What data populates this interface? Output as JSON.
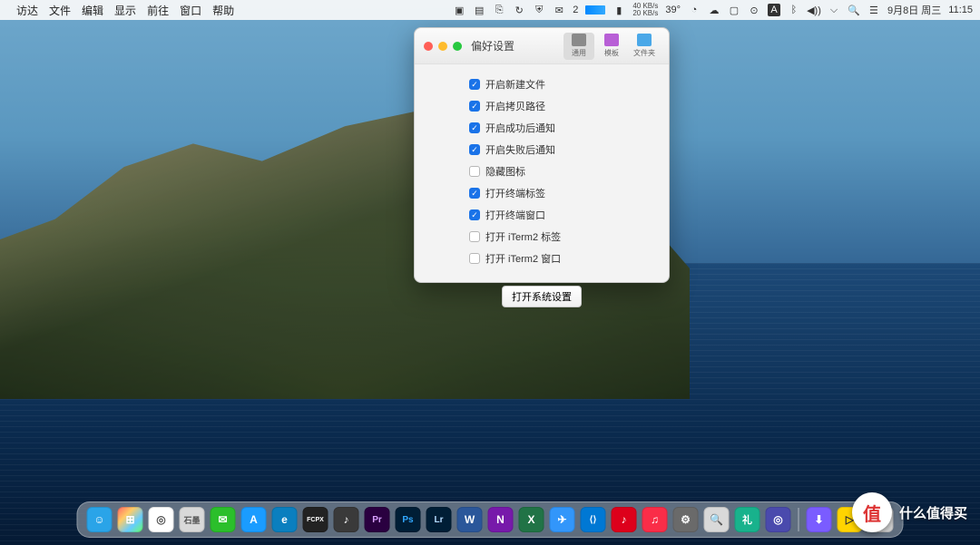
{
  "menubar": {
    "apple": "",
    "items": [
      "访达",
      "文件",
      "编辑",
      "显示",
      "前往",
      "窗口",
      "帮助"
    ],
    "status": {
      "badge_count": "2",
      "net_up": "40 KB/s",
      "net_dn": "20 KB/s",
      "temp": "39°",
      "date": "9月8日 周三",
      "time": "11:15"
    }
  },
  "panel": {
    "title": "偏好设置",
    "tabs": [
      {
        "key": "general",
        "label": "通用",
        "active": true
      },
      {
        "key": "template",
        "label": "模板",
        "active": false
      },
      {
        "key": "folder",
        "label": "文件夹",
        "active": false
      }
    ],
    "options": [
      {
        "key": "new_file",
        "label": "开启新建文件",
        "checked": true
      },
      {
        "key": "copy_path",
        "label": "开启拷贝路径",
        "checked": true
      },
      {
        "key": "success_notify",
        "label": "开启成功后通知",
        "checked": true
      },
      {
        "key": "fail_notify",
        "label": "开启失败后通知",
        "checked": true
      },
      {
        "key": "hide_icon",
        "label": "隐藏图标",
        "checked": false
      },
      {
        "key": "open_term_tab",
        "label": "打开终端标签",
        "checked": true
      },
      {
        "key": "open_term_win",
        "label": "打开终端窗口",
        "checked": true
      },
      {
        "key": "open_iterm_tab",
        "label": "打开 iTerm2 标签",
        "checked": false
      },
      {
        "key": "open_iterm_win",
        "label": "打开 iTerm2 窗口",
        "checked": false
      }
    ],
    "sys_button": "打开系统设置"
  },
  "dock": {
    "apps": [
      {
        "key": "finder",
        "glyph": "☺",
        "bg": "#2aa4e8"
      },
      {
        "key": "launchpad",
        "glyph": "⊞",
        "bg": "linear-gradient(135deg,#f66,#fc6,#6cf,#6f6)"
      },
      {
        "key": "chrome",
        "glyph": "◎",
        "bg": "#fff",
        "fg": "#555"
      },
      {
        "key": "stone",
        "glyph": "石墨",
        "bg": "#d9d9d9",
        "fg": "#555",
        "fs": "9px"
      },
      {
        "key": "wechat",
        "glyph": "✉",
        "bg": "#2bbf2b"
      },
      {
        "key": "appstore",
        "glyph": "A",
        "bg": "#1a9cff"
      },
      {
        "key": "edge",
        "glyph": "e",
        "bg": "#0a7fbf"
      },
      {
        "key": "fcpx",
        "glyph": "FCPX",
        "bg": "#222",
        "fs": "7px"
      },
      {
        "key": "logic",
        "glyph": "♪",
        "bg": "#3a3a3a"
      },
      {
        "key": "pr",
        "glyph": "Pr",
        "bg": "#2a0040",
        "fs": "10px",
        "fg": "#d9a0ff"
      },
      {
        "key": "ps",
        "glyph": "Ps",
        "bg": "#001e36",
        "fs": "10px",
        "fg": "#31a8ff"
      },
      {
        "key": "lr",
        "glyph": "Lr",
        "bg": "#001e36",
        "fs": "10px",
        "fg": "#b4dcff"
      },
      {
        "key": "word",
        "glyph": "W",
        "bg": "#2b579a"
      },
      {
        "key": "onenote",
        "glyph": "N",
        "bg": "#7719aa"
      },
      {
        "key": "excel",
        "glyph": "X",
        "bg": "#217346"
      },
      {
        "key": "dingtalk",
        "glyph": "✈",
        "bg": "#3296fa"
      },
      {
        "key": "vscode",
        "glyph": "⟨⟩",
        "bg": "#0078d4",
        "fs": "10px"
      },
      {
        "key": "netease",
        "glyph": "♪",
        "bg": "#dd001b"
      },
      {
        "key": "music",
        "glyph": "♫",
        "bg": "#fa2d48"
      },
      {
        "key": "settings",
        "glyph": "⚙",
        "bg": "#6a6a6a"
      },
      {
        "key": "spotlight",
        "glyph": "🔍",
        "bg": "#d9d9d9",
        "fg": "#444"
      },
      {
        "key": "liqing",
        "glyph": "礼",
        "bg": "#18b28c",
        "fs": "11px"
      },
      {
        "key": "readcube",
        "glyph": "◎",
        "bg": "#4a4aad"
      }
    ],
    "tray": [
      {
        "key": "downloads",
        "glyph": "⬇︎",
        "bg": "#7a5cff"
      },
      {
        "key": "trash",
        "glyph": "▷",
        "bg": "#ffd400",
        "fg": "#333"
      },
      {
        "key": "bin",
        "glyph": "🗑",
        "bg": "#cfcfcf",
        "fg": "#555"
      }
    ]
  },
  "watermark": {
    "glyph": "值",
    "text": "什么值得买"
  }
}
